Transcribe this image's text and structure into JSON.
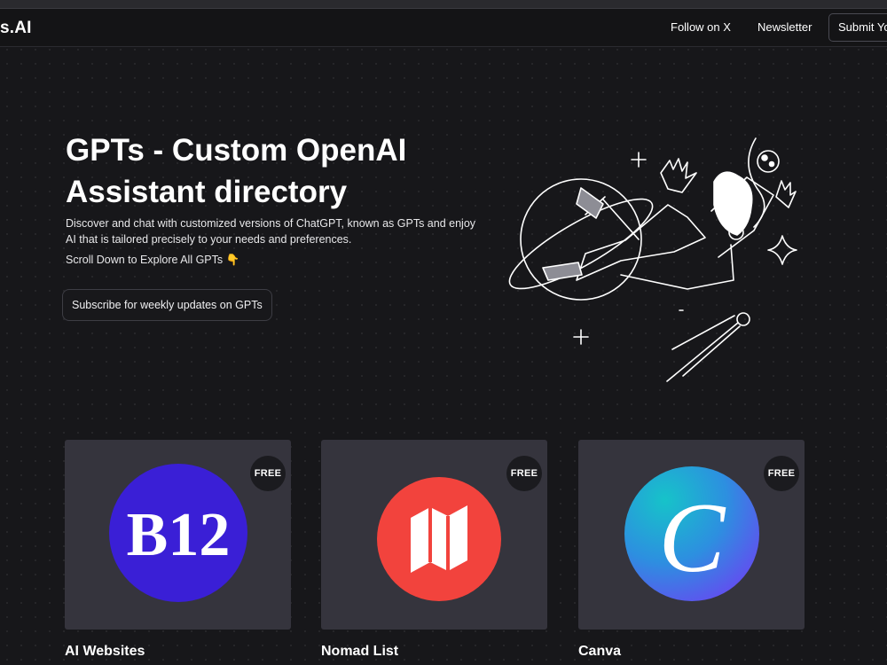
{
  "brand": {
    "logo_text": "s.AI"
  },
  "nav": {
    "follow": "Follow on X",
    "newsletter": "Newsletter",
    "submit": "Submit Yo"
  },
  "hero": {
    "title_line1": "GPTs - Custom OpenAI",
    "title_line2": "Assistant directory",
    "description": "Discover and chat with customized versions of ChatGPT, known as GPTs and enjoy AI that is tailored precisely to your needs and preferences.",
    "scroll_hint": "Scroll Down to Explore All GPTs 👇",
    "subscribe_button": "Subscribe for weekly updates on GPTs"
  },
  "cards": [
    {
      "title": "AI Websites",
      "badge": "FREE",
      "logo_text": "B12",
      "logo_color": "#3a1fd6"
    },
    {
      "title": "Nomad List",
      "badge": "FREE",
      "logo_color": "#f2433d"
    },
    {
      "title": "Canva",
      "badge": "FREE",
      "logo_text": "C",
      "logo_colors": [
        "#16c3c9",
        "#7b2ff7"
      ]
    }
  ],
  "icons": {
    "illustration": "astronaut-floating-illustration",
    "nomad-logo": "folded-map-icon"
  }
}
